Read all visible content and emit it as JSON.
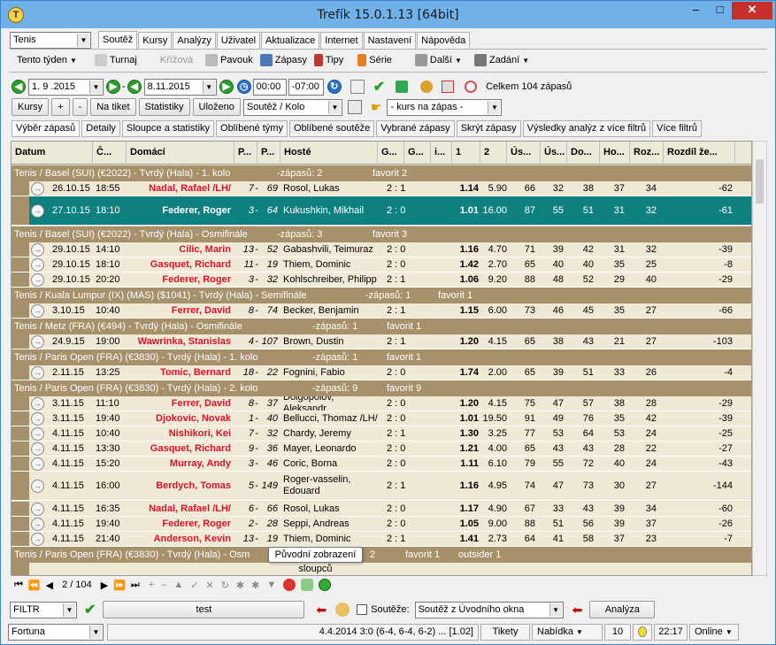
{
  "window": {
    "title": "Trefík 15.0.1.13 [64bit]"
  },
  "toolbar1": {
    "sport": "Tenis",
    "tabs": [
      "Soutěž",
      "Kursy",
      "Analýzy",
      "Uživatel",
      "Aktualizace",
      "Internet",
      "Nastavení",
      "Nápověda"
    ]
  },
  "toolbar2": {
    "period": "Tento týden",
    "turnaj": "Turnaj",
    "krizova": "Křížová",
    "pavouk": "Pavouk",
    "zapasy": "Zápasy",
    "tipy": "Tipy",
    "serie": "Série",
    "dalsi": "Další",
    "zadani": "Zadání"
  },
  "datebar": {
    "date_from": " 1. 9 .2015",
    "date_to": " 8.11.2015",
    "time_from": "00:00",
    "time_to": "-07:00",
    "total": "Celkem 104 zápasů"
  },
  "buttonbar": {
    "kursy": "Kursy",
    "plus": "+",
    "minus": "-",
    "na_tiket": "Na tiket",
    "statistiky": "Statistiky",
    "ulozeno": "Uloženo",
    "soutez_kolo": "Soutěž / Kolo",
    "kurs_na_zapas": "- kurs na zápas -"
  },
  "subtabs": [
    "Výběr zápasů",
    "Detaily",
    "Sloupce a statistiky",
    "Oblíbené týmy",
    "Oblíbené soutěže",
    "Vybrané zápasy",
    "Skrýt zápasy",
    "Výsledky analýz z více filtrů",
    "Více filtrů"
  ],
  "columns": [
    "Datum",
    "Č...",
    "Domácí",
    "P...",
    "P...",
    "Hosté",
    "G...",
    "G...",
    "i...",
    "1",
    "2",
    "Ús...",
    "Ús...",
    "Do...",
    "Ho...",
    "Roz...",
    "Rozdíl že..."
  ],
  "groups": [
    {
      "label": "Tenis / Basel (SUI)  (€2022) - Tvrdý (Hala) - 1. kolo",
      "count": "-zápasů: 2",
      "fav": "favorit 2",
      "out": ""
    },
    {
      "label": "Tenis / Basel (SUI)  (€2022) - Tvrdý (Hala) - Osmifinále",
      "count": "-zápasů: 3",
      "fav": "favorit 3",
      "out": ""
    },
    {
      "label": "Tenis / Kuala Lumpur (IX) (MAS)  ($1041) - Tvrdý (Hala) - Semifinále",
      "count": "-zápasů: 1",
      "fav": "favorit 1",
      "out": ""
    },
    {
      "label": "Tenis / Metz (FRA)  (€494) - Tvrdý (Hala) - Osmifinále",
      "count": "-zápasů: 1",
      "fav": "favorit 1",
      "out": ""
    },
    {
      "label": "Tenis / Paris Open (FRA)  (€3830) - Tvrdý (Hala) - 1. kolo",
      "count": "-zápasů: 1",
      "fav": "favorit 1",
      "out": ""
    },
    {
      "label": "Tenis / Paris Open (FRA)  (€3830) - Tvrdý (Hala) - 2. kolo",
      "count": "-zápasů: 9",
      "fav": "favorit 9",
      "out": ""
    },
    {
      "label": "Tenis / Paris Open (FRA)  (€3830) - Tvrdý (Hala) - Osm",
      "count": "2",
      "fav": "favorit 1",
      "out": "outsider 1"
    }
  ],
  "matches": [
    {
      "d": "26.10.15",
      "t": "18:55",
      "home": "Nadal, Rafael /LH/",
      "p1": "7",
      "p2": "69",
      "away": "Rosol, Lukas",
      "score": "2 : 1",
      "k1": "1.14",
      "k2": "5.90",
      "u1": "66",
      "u2": "32",
      "do": "38",
      "ho": "37",
      "roz": "34",
      "rz": "-62"
    },
    {
      "d": "27.10.15",
      "t": "18:10",
      "home": "Federer, Roger",
      "p1": "3",
      "p2": "64",
      "away": "Kukushkin, Mikhail",
      "score": "2 : 0",
      "k1": "1.01",
      "k2": "16.00",
      "u1": "87",
      "u2": "55",
      "do": "51",
      "ho": "31",
      "roz": "32",
      "rz": "-61"
    },
    {
      "d": "29.10.15",
      "t": "14:10",
      "home": "Cilic, Marin",
      "p1": "13",
      "p2": "52",
      "away": "Gabashvili, Teimuraz",
      "score": "2 : 0",
      "k1": "1.16",
      "k2": "4.70",
      "u1": "71",
      "u2": "39",
      "do": "42",
      "ho": "31",
      "roz": "32",
      "rz": "-39"
    },
    {
      "d": "29.10.15",
      "t": "18:10",
      "home": "Gasquet, Richard",
      "p1": "11",
      "p2": "19",
      "away": "Thiem, Dominic",
      "score": "2 : 0",
      "k1": "1.42",
      "k2": "2.70",
      "u1": "65",
      "u2": "40",
      "do": "40",
      "ho": "35",
      "roz": "25",
      "rz": "-8"
    },
    {
      "d": "29.10.15",
      "t": "20:20",
      "home": "Federer, Roger",
      "p1": "3",
      "p2": "32",
      "away": "Kohlschreiber, Philipp",
      "score": "2 : 1",
      "k1": "1.06",
      "k2": "9.20",
      "u1": "88",
      "u2": "48",
      "do": "52",
      "ho": "29",
      "roz": "40",
      "rz": "-29"
    },
    {
      "d": "3.10.15",
      "t": "10:40",
      "home": "Ferrer, David",
      "p1": "8",
      "p2": "74",
      "away": "Becker, Benjamin",
      "score": "2 : 1",
      "k1": "1.15",
      "k2": "6.00",
      "u1": "73",
      "u2": "46",
      "do": "45",
      "ho": "35",
      "roz": "27",
      "rz": "-66"
    },
    {
      "d": "24.9.15",
      "t": "19:00",
      "home": "Wawrinka, Stanislas",
      "p1": "4",
      "p2": "107",
      "away": "Brown, Dustin",
      "score": "2 : 1",
      "k1": "1.20",
      "k2": "4.15",
      "u1": "65",
      "u2": "38",
      "do": "43",
      "ho": "21",
      "roz": "27",
      "rz": "-103"
    },
    {
      "d": "2.11.15",
      "t": "13:25",
      "home": "Tomic, Bernard",
      "p1": "18",
      "p2": "22",
      "away": "Fognini, Fabio",
      "score": "2 : 0",
      "k1": "1.74",
      "k2": "2.00",
      "u1": "65",
      "u2": "39",
      "do": "51",
      "ho": "33",
      "roz": "26",
      "rz": "-4"
    },
    {
      "d": "3.11.15",
      "t": "11:10",
      "home": "Ferrer, David",
      "p1": "8",
      "p2": "37",
      "away": "Dolgopolov, Aleksandr",
      "score": "2 : 0",
      "k1": "1.20",
      "k2": "4.15",
      "u1": "75",
      "u2": "47",
      "do": "57",
      "ho": "38",
      "roz": "28",
      "rz": "-29"
    },
    {
      "d": "3.11.15",
      "t": "19:40",
      "home": "Djokovic, Novak",
      "p1": "1",
      "p2": "40",
      "away": "Bellucci, Thomaz /LH/",
      "score": "2 : 0",
      "k1": "1.01",
      "k2": "19.50",
      "u1": "91",
      "u2": "49",
      "do": "76",
      "ho": "35",
      "roz": "42",
      "rz": "-39"
    },
    {
      "d": "4.11.15",
      "t": "10:40",
      "home": "Nishikori, Kei",
      "p1": "7",
      "p2": "32",
      "away": "Chardy, Jeremy",
      "score": "2 : 1",
      "k1": "1.30",
      "k2": "3.25",
      "u1": "77",
      "u2": "53",
      "do": "64",
      "ho": "53",
      "roz": "24",
      "rz": "-25"
    },
    {
      "d": "4.11.15",
      "t": "13:30",
      "home": "Gasquet, Richard",
      "p1": "9",
      "p2": "36",
      "away": "Mayer, Leonardo",
      "score": "2 : 0",
      "k1": "1.21",
      "k2": "4.00",
      "u1": "65",
      "u2": "43",
      "do": "43",
      "ho": "28",
      "roz": "22",
      "rz": "-27"
    },
    {
      "d": "4.11.15",
      "t": "15:20",
      "home": "Murray, Andy",
      "p1": "3",
      "p2": "46",
      "away": "Coric, Borna",
      "score": "2 : 0",
      "k1": "1.11",
      "k2": "6.10",
      "u1": "79",
      "u2": "55",
      "do": "72",
      "ho": "40",
      "roz": "24",
      "rz": "-43"
    },
    {
      "d": "4.11.15",
      "t": "16:00",
      "home": "Berdych, Tomas",
      "p1": "5",
      "p2": "149",
      "away": "Roger-vasselin, Edouard",
      "score": "2 : 1",
      "k1": "1.16",
      "k2": "4.95",
      "u1": "74",
      "u2": "47",
      "do": "73",
      "ho": "30",
      "roz": "27",
      "rz": "-144"
    },
    {
      "d": "4.11.15",
      "t": "16:35",
      "home": "Nadal, Rafael /LH/",
      "p1": "6",
      "p2": "66",
      "away": "Rosol, Lukas",
      "score": "2 : 0",
      "k1": "1.17",
      "k2": "4.90",
      "u1": "67",
      "u2": "33",
      "do": "43",
      "ho": "39",
      "roz": "34",
      "rz": "-60"
    },
    {
      "d": "4.11.15",
      "t": "19:40",
      "home": "Federer, Roger",
      "p1": "2",
      "p2": "28",
      "away": "Seppi, Andreas",
      "score": "2 : 0",
      "k1": "1.05",
      "k2": "9.00",
      "u1": "88",
      "u2": "51",
      "do": "56",
      "ho": "39",
      "roz": "37",
      "rz": "-26"
    },
    {
      "d": "4.11.15",
      "t": "21:40",
      "home": "Anderson, Kevin",
      "p1": "13",
      "p2": "19",
      "away": "Thiem, Dominic",
      "score": "2 : 1",
      "k1": "1.41",
      "k2": "2.73",
      "u1": "64",
      "u2": "41",
      "do": "58",
      "ho": "37",
      "roz": "23",
      "rz": "-7"
    }
  ],
  "nav": {
    "page": "2 / 104"
  },
  "tooltip": "Původní zobrazení sloupců",
  "bottom": {
    "filtr": "FILTR",
    "test": "test",
    "soutez_label": "Soutěže:",
    "soutez_value": "Soutěž z Úvodního okna",
    "analyza": "Analýza"
  },
  "status": {
    "fortuna": "Fortuna",
    "info": "4.4.2014 3:0 (6-4, 6-4, 6-2) ... [1.02]",
    "tikety": "Tikety",
    "nabidka": "Nabídka",
    "num": "10",
    "time": "22:17",
    "online": "Online"
  }
}
